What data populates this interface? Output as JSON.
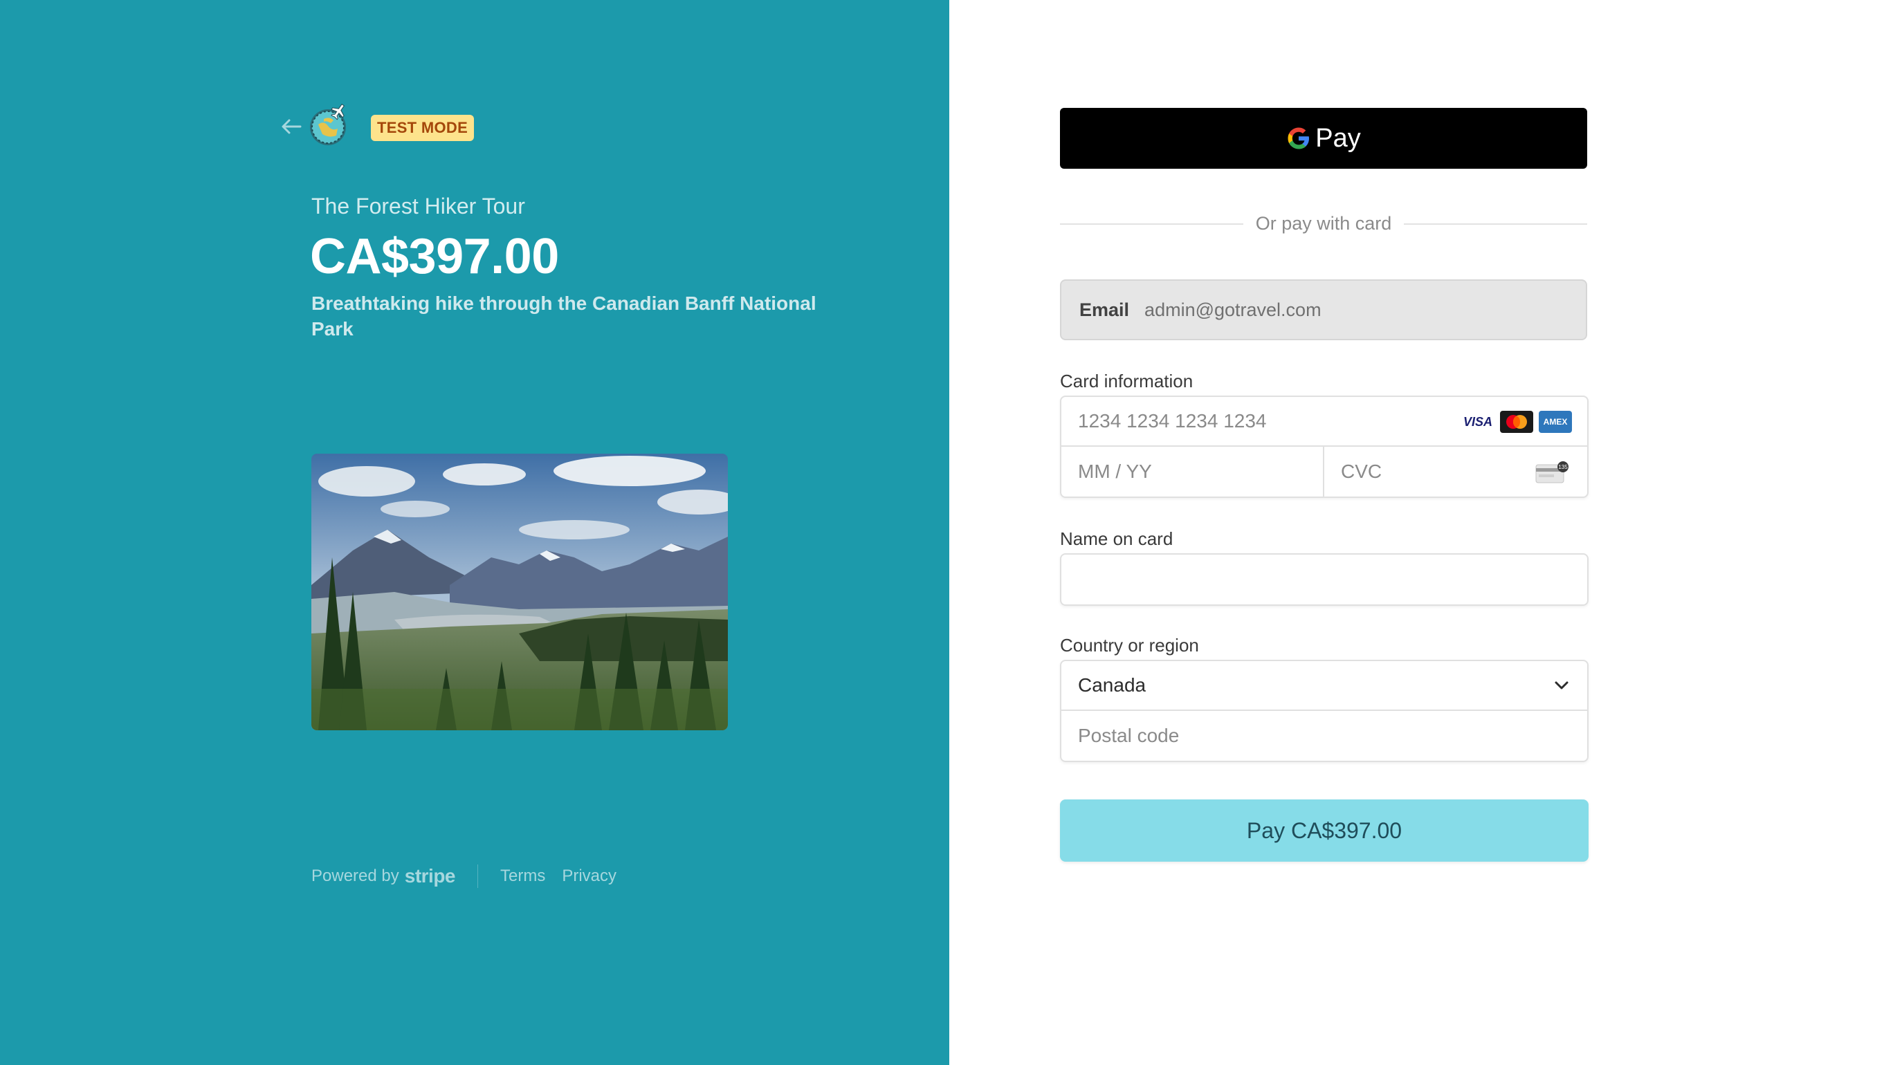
{
  "colors": {
    "left_panel_bg": "#1c9aab",
    "test_badge_bg": "#fde38c",
    "gpay_bg": "#000000",
    "pay_button_bg": "#86dce8"
  },
  "header": {
    "back_icon": "arrow-left-icon",
    "logo_icon": "travel-logo-icon",
    "test_mode_label": "TEST MODE"
  },
  "product": {
    "name": "The Forest Hiker Tour",
    "price": "CA$397.00",
    "description": "Breathtaking hike through the Canadian Banff National Park",
    "image": "mountain-forest-landscape"
  },
  "footer": {
    "powered_by": "Powered by",
    "brand": "stripe",
    "terms": "Terms",
    "privacy": "Privacy"
  },
  "payment": {
    "gpay_label": "Pay",
    "divider_text": "Or pay with card",
    "email_label": "Email",
    "email_value": "admin@gotravel.com",
    "card_info_label": "Card information",
    "card_number_placeholder": "1234 1234 1234 1234",
    "card_brands": [
      "VISA",
      "mastercard",
      "AMEX"
    ],
    "expiry_placeholder": "MM / YY",
    "cvc_placeholder": "CVC",
    "cvc_badge": "135",
    "name_label": "Name on card",
    "name_value": "",
    "country_label": "Country or region",
    "country_value": "Canada",
    "postal_placeholder": "Postal code",
    "pay_button_label": "Pay CA$397.00"
  }
}
